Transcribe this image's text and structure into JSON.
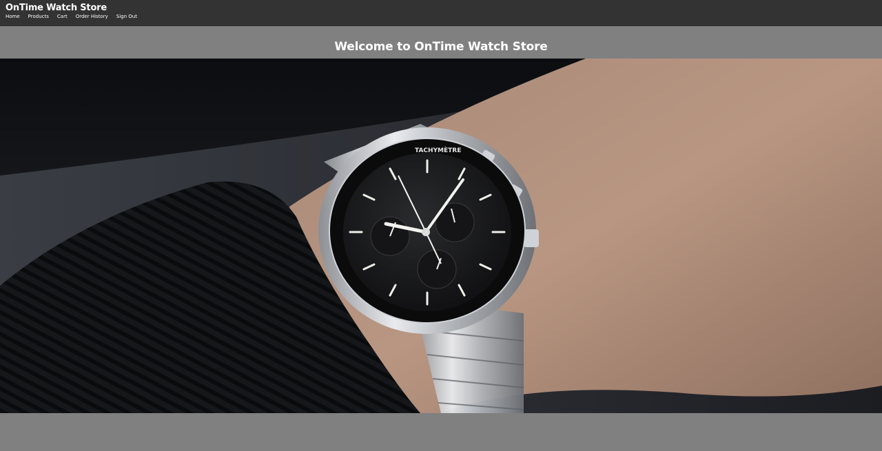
{
  "header": {
    "brand": "OnTime Watch Store",
    "nav": [
      {
        "label": "Home"
      },
      {
        "label": "Products"
      },
      {
        "label": "Cart"
      },
      {
        "label": "Order History"
      },
      {
        "label": "Sign Out"
      }
    ]
  },
  "main": {
    "welcome": "Welcome to OnTime Watch Store",
    "hero_watch_dial": {
      "bezel_text": "TACHYMÈTRE"
    }
  },
  "colors": {
    "topbar": "#333333",
    "band": "#808080",
    "text": "#ffffff"
  }
}
